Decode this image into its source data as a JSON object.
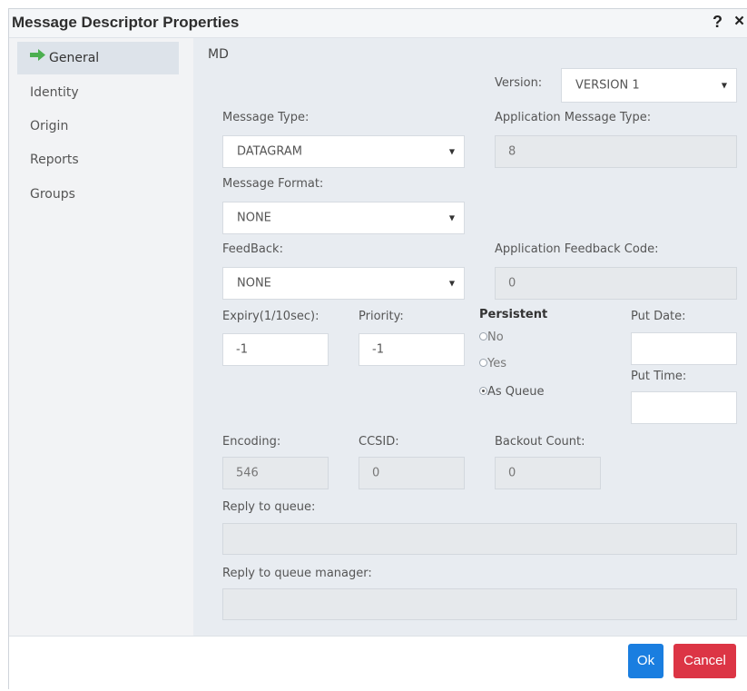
{
  "dialog": {
    "title": "Message Descriptor Properties",
    "help": "?",
    "close": "×"
  },
  "sidebar": {
    "items": [
      {
        "label": "General",
        "active": true,
        "icon": "green-arrow-right-icon"
      },
      {
        "label": "Identity",
        "active": false
      },
      {
        "label": "Origin",
        "active": false
      },
      {
        "label": "Reports",
        "active": false
      },
      {
        "label": "Groups",
        "active": false
      }
    ]
  },
  "main": {
    "section_title": "MD",
    "version": {
      "label": "Version:",
      "value": "VERSION 1"
    },
    "message_type": {
      "label": "Message Type:",
      "value": "DATAGRAM"
    },
    "app_message_type": {
      "label": "Application Message Type:",
      "value": "8"
    },
    "message_format": {
      "label": "Message Format:",
      "value": "NONE"
    },
    "feedback": {
      "label": "FeedBack:",
      "value": "NONE"
    },
    "app_feedback_code": {
      "label": "Application Feedback Code:",
      "value": "0"
    },
    "expiry": {
      "label": "Expiry(1/10sec):",
      "value": "-1"
    },
    "priority": {
      "label": "Priority:",
      "value": "-1"
    },
    "persistent": {
      "label": "Persistent",
      "options": [
        "No",
        "Yes",
        "As Queue"
      ],
      "selected": "As Queue"
    },
    "put_date": {
      "label": "Put Date:",
      "value": ""
    },
    "put_time": {
      "label": "Put Time:",
      "value": ""
    },
    "encoding": {
      "label": "Encoding:",
      "value": "546"
    },
    "ccsid": {
      "label": "CCSID:",
      "value": "0"
    },
    "backout_count": {
      "label": "Backout Count:",
      "value": "0"
    },
    "reply_to_queue": {
      "label": "Reply to queue:",
      "value": ""
    },
    "reply_to_queue_manager": {
      "label": "Reply to queue manager:",
      "value": ""
    }
  },
  "footer": {
    "ok_label": "Ok",
    "cancel_label": "Cancel"
  },
  "colors": {
    "ok_button": "#1a7ee0",
    "cancel_button": "#dc3545",
    "nav_active_bg": "#dde3ea",
    "main_bg": "#e8ecf1",
    "arrow_icon": "#4caf50"
  }
}
